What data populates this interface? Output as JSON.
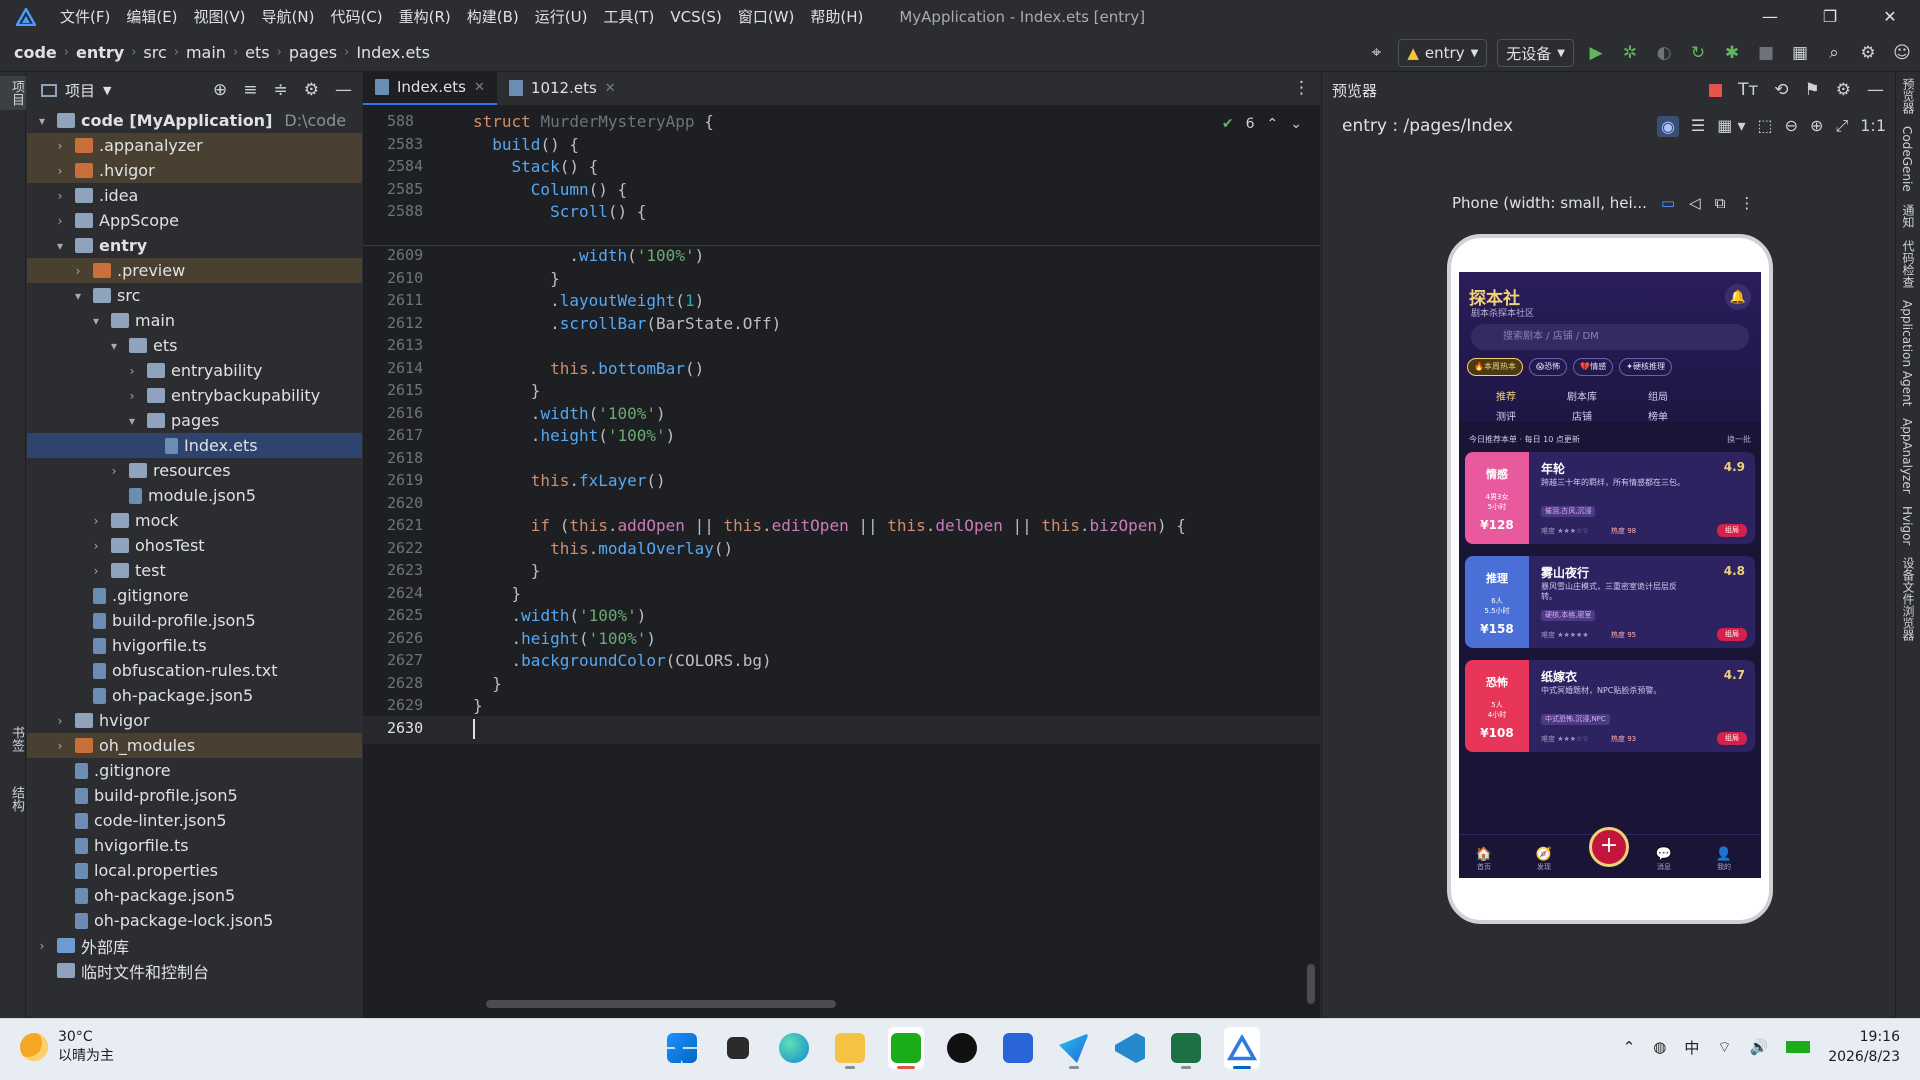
{
  "menubar": {
    "items": [
      "文件(F)",
      "编辑(E)",
      "视图(V)",
      "导航(N)",
      "代码(C)",
      "重构(R)",
      "构建(B)",
      "运行(U)",
      "工具(T)",
      "VCS(S)",
      "窗口(W)",
      "帮助(H)"
    ],
    "title": "MyApplication - Index.ets [entry]",
    "controls": [
      "—",
      "❐",
      "✕"
    ]
  },
  "navbar": {
    "breadcrumb": [
      "code",
      "entry",
      "src",
      "main",
      "ets",
      "pages",
      "Index.ets"
    ],
    "run_config": "entry",
    "device": "无设备"
  },
  "left_strip": {
    "top_label": "项目",
    "bottom_labels": [
      "书签",
      "结构"
    ]
  },
  "project": {
    "title": "项目",
    "tree": [
      {
        "label": "code [MyApplication]",
        "extra": "D:\\code",
        "depth": 0,
        "arrow": "▾",
        "icon": "folder",
        "bold": true
      },
      {
        "label": ".appanalyzer",
        "depth": 1,
        "arrow": "›",
        "icon": "folder-orange",
        "hl": true
      },
      {
        "label": ".hvigor",
        "depth": 1,
        "arrow": "›",
        "icon": "folder-orange",
        "hl": true
      },
      {
        "label": ".idea",
        "depth": 1,
        "arrow": "›",
        "icon": "folder"
      },
      {
        "label": "AppScope",
        "depth": 1,
        "arrow": "›",
        "icon": "folder"
      },
      {
        "label": "entry",
        "depth": 1,
        "arrow": "▾",
        "icon": "folder",
        "bold": true
      },
      {
        "label": ".preview",
        "depth": 2,
        "arrow": "›",
        "icon": "folder-orange",
        "hl": true
      },
      {
        "label": "src",
        "depth": 2,
        "arrow": "▾",
        "icon": "folder"
      },
      {
        "label": "main",
        "depth": 3,
        "arrow": "▾",
        "icon": "folder"
      },
      {
        "label": "ets",
        "depth": 4,
        "arrow": "▾",
        "icon": "folder"
      },
      {
        "label": "entryability",
        "depth": 5,
        "arrow": "›",
        "icon": "folder"
      },
      {
        "label": "entrybackupability",
        "depth": 5,
        "arrow": "›",
        "icon": "folder"
      },
      {
        "label": "pages",
        "depth": 5,
        "arrow": "▾",
        "icon": "folder"
      },
      {
        "label": "Index.ets",
        "depth": 6,
        "arrow": "",
        "icon": "file",
        "sel": true
      },
      {
        "label": "resources",
        "depth": 4,
        "arrow": "›",
        "icon": "folder"
      },
      {
        "label": "module.json5",
        "depth": 4,
        "arrow": "",
        "icon": "file"
      },
      {
        "label": "mock",
        "depth": 3,
        "arrow": "›",
        "icon": "folder"
      },
      {
        "label": "ohosTest",
        "depth": 3,
        "arrow": "›",
        "icon": "folder"
      },
      {
        "label": "test",
        "depth": 3,
        "arrow": "›",
        "icon": "folder"
      },
      {
        "label": ".gitignore",
        "depth": 2,
        "arrow": "",
        "icon": "file"
      },
      {
        "label": "build-profile.json5",
        "depth": 2,
        "arrow": "",
        "icon": "file"
      },
      {
        "label": "hvigorfile.ts",
        "depth": 2,
        "arrow": "",
        "icon": "file"
      },
      {
        "label": "obfuscation-rules.txt",
        "depth": 2,
        "arrow": "",
        "icon": "file"
      },
      {
        "label": "oh-package.json5",
        "depth": 2,
        "arrow": "",
        "icon": "file"
      },
      {
        "label": "hvigor",
        "depth": 1,
        "arrow": "›",
        "icon": "folder"
      },
      {
        "label": "oh_modules",
        "depth": 1,
        "arrow": "›",
        "icon": "folder-orange",
        "hl": true
      },
      {
        "label": ".gitignore",
        "depth": 1,
        "arrow": "",
        "icon": "file"
      },
      {
        "label": "build-profile.json5",
        "depth": 1,
        "arrow": "",
        "icon": "file"
      },
      {
        "label": "code-linter.json5",
        "depth": 1,
        "arrow": "",
        "icon": "file"
      },
      {
        "label": "hvigorfile.ts",
        "depth": 1,
        "arrow": "",
        "icon": "file"
      },
      {
        "label": "local.properties",
        "depth": 1,
        "arrow": "",
        "icon": "file"
      },
      {
        "label": "oh-package.json5",
        "depth": 1,
        "arrow": "",
        "icon": "file"
      },
      {
        "label": "oh-package-lock.json5",
        "depth": 1,
        "arrow": "",
        "icon": "file"
      },
      {
        "label": "外部库",
        "depth": 0,
        "arrow": "›",
        "icon": "lib"
      },
      {
        "label": "临时文件和控制台",
        "depth": 0,
        "arrow": "",
        "icon": "scratch"
      }
    ]
  },
  "editor": {
    "tabs": [
      {
        "label": "Index.ets",
        "active": true
      },
      {
        "label": "1012.ets",
        "active": false
      }
    ],
    "inspection_count": "6",
    "sticky_lines": [
      {
        "n": "588",
        "html": "<span class='kw'>struct</span> <span class='dim'>MurderMysteryApp</span> {"
      },
      {
        "n": "2583",
        "html": "  <span class='fn'>build</span>() {"
      },
      {
        "n": "2584",
        "html": "    <span class='fn'>Stack</span>() {"
      },
      {
        "n": "2585",
        "html": "      <span class='fn'>Column</span>() {"
      },
      {
        "n": "2588",
        "html": "        <span class='fn'>Scroll</span>() {"
      }
    ],
    "lines": [
      {
        "n": "2609",
        "html": "          .<span class='fn'>width</span>(<span class='st'>'100%'</span>)"
      },
      {
        "n": "2610",
        "html": "        }"
      },
      {
        "n": "2611",
        "html": "        .<span class='fn'>layoutWeight</span>(<span class='nm'>1</span>)"
      },
      {
        "n": "2612",
        "html": "        .<span class='fn'>scrollBar</span>(BarState.<span class='cls'>Off</span>)"
      },
      {
        "n": "2613",
        "html": ""
      },
      {
        "n": "2614",
        "html": "        <span class='kw'>this</span>.<span class='fn'>bottomBar</span>()"
      },
      {
        "n": "2615",
        "html": "      }"
      },
      {
        "n": "2616",
        "html": "      .<span class='fn'>width</span>(<span class='st'>'100%'</span>)"
      },
      {
        "n": "2617",
        "html": "      .<span class='fn'>height</span>(<span class='st'>'100%'</span>)"
      },
      {
        "n": "2618",
        "html": ""
      },
      {
        "n": "2619",
        "html": "      <span class='kw'>this</span>.<span class='fn'>fxLayer</span>()"
      },
      {
        "n": "2620",
        "html": ""
      },
      {
        "n": "2621",
        "html": "      <span class='kw'>if</span> (<span class='kw'>this</span>.<span class='mem'>addOpen</span> || <span class='kw'>this</span>.<span class='mem'>editOpen</span> || <span class='kw'>this</span>.<span class='mem'>delOpen</span> || <span class='kw'>this</span>.<span class='mem'>bizOpen</span>) {"
      },
      {
        "n": "2622",
        "html": "        <span class='kw'>this</span>.<span class='fn'>modalOverlay</span>()"
      },
      {
        "n": "2623",
        "html": "      }"
      },
      {
        "n": "2624",
        "html": "    }"
      },
      {
        "n": "2625",
        "html": "    .<span class='fn'>width</span>(<span class='st'>'100%'</span>)"
      },
      {
        "n": "2626",
        "html": "    .<span class='fn'>height</span>(<span class='st'>'100%'</span>)"
      },
      {
        "n": "2627",
        "html": "    .<span class='fn'>backgroundColor</span>(COLORS.<span class='cls'>bg</span>)"
      },
      {
        "n": "2628",
        "html": "  }"
      },
      {
        "n": "2629",
        "html": "}"
      },
      {
        "n": "2630",
        "html": ""
      }
    ]
  },
  "preview": {
    "title": "预览器",
    "path": "entry : /pages/Index",
    "device_label": "Phone (width: small, hei...",
    "app": {
      "title": "探本社",
      "subtitle": "剧本杀探本社区",
      "search_placeholder": "搜索剧本 / 店铺 / DM",
      "chips": [
        "🔥本周热本",
        "😱恐怖",
        "💔情感",
        "✦硬核推理"
      ],
      "nav": [
        "推荐",
        "剧本库",
        "组局",
        "测评",
        "店铺",
        "榜单"
      ],
      "notice": "今日推荐本单 · 每日 10 点更新",
      "notice_action": "换一批",
      "cards": [
        {
          "tag": "情感",
          "meta1": "4男3女",
          "meta2": "5小时",
          "price": "¥128",
          "name": "年轮",
          "rating": "4.9",
          "desc": "跨越三十年的羁绊，所有情感都在三包。",
          "tags": "催泪,古风,沉浸",
          "stars": "难度 ★★★☆☆",
          "heat": "热度 98",
          "btn": "组局",
          "color": "#e85a9d"
        },
        {
          "tag": "推理",
          "meta1": "6人",
          "meta2": "5.5小时",
          "price": "¥158",
          "name": "雾山夜行",
          "rating": "4.8",
          "desc": "暴风雪山庄模式，三重密室诡计层层反转。",
          "tags": "硬核,本格,密室",
          "stars": "难度 ★★★★★",
          "heat": "热度 95",
          "btn": "组局",
          "color": "#4a70d8"
        },
        {
          "tag": "恐怖",
          "meta1": "5人",
          "meta2": "4小时",
          "price": "¥108",
          "name": "纸嫁衣",
          "rating": "4.7",
          "desc": "中式冥婚题材，NPC贴脸杀预警。",
          "tags": "中式恐怖,沉浸,NPC",
          "stars": "难度 ★★★☆☆",
          "heat": "热度 93",
          "btn": "组局",
          "color": "#e8365a"
        }
      ],
      "tabbar": [
        "首页",
        "发现",
        "",
        "消息",
        "我的"
      ]
    }
  },
  "right_strip": [
    "预览器",
    "CodeGenie",
    "通知",
    "代码检查",
    "Application Agent",
    "AppAnalyzer",
    "Hvigor",
    "设备文件浏览器"
  ],
  "taskbar": {
    "weather_temp": "30°C",
    "weather_desc": "以晴为主",
    "ime": "中",
    "time": "19:16",
    "date": "2026/8/23"
  }
}
